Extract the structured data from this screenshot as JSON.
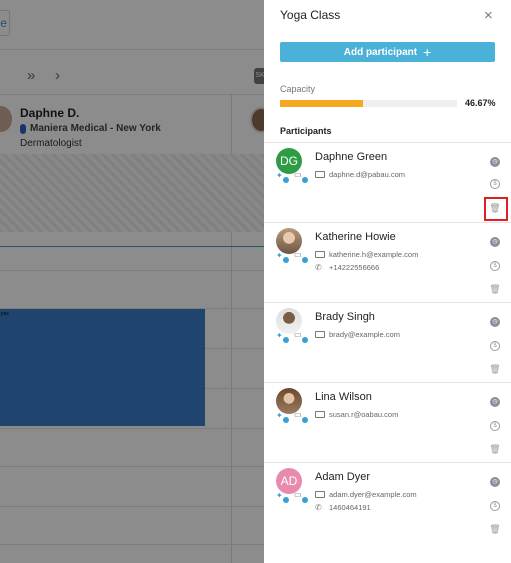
{
  "background": {
    "edge_button": "e",
    "nav_next_double": "»",
    "nav_next": "›",
    "sk_badge": "SK",
    "staff": {
      "name": "Daphne D.",
      "location": "Maniera Medical - New York",
      "role": "Dermatologist"
    },
    "block_label": "pss"
  },
  "panel": {
    "title": "Yoga Class",
    "close_symbol": "×",
    "add_button_label": "Add participant",
    "add_button_plus": "+",
    "capacity_label": "Capacity",
    "capacity_fraction": 0.4667,
    "capacity_percent_text": "46.67%",
    "participants_heading": "Participants",
    "participants": [
      {
        "name": "Daphne Green",
        "initials": "DG",
        "avatar_color": "#2e9b45",
        "email": "daphne.d@pabau.com",
        "phone": ""
      },
      {
        "name": "Katherine Howie",
        "initials": "",
        "email": "katherine.h@example.com",
        "phone": "+14222556666"
      },
      {
        "name": "Brady Singh",
        "initials": "",
        "email": "brady@example.com",
        "phone": ""
      },
      {
        "name": "Lina Wilson",
        "initials": "",
        "email": "susan.r@oabau.com",
        "phone": ""
      },
      {
        "name": "Adam Dyer",
        "initials": "AD",
        "avatar_color": "#e88aae",
        "email": "adam.dyer@example.com",
        "phone": "1460464191"
      }
    ]
  },
  "colors": {
    "accent": "#4ab1d8",
    "capacity_fill": "#f5a81e",
    "highlight": "#e02020"
  },
  "icons": {
    "clock": "clock-icon",
    "dollar": "dollar-icon",
    "trash": "trash-icon",
    "mail": "mail-icon",
    "phone": "phone-icon"
  }
}
